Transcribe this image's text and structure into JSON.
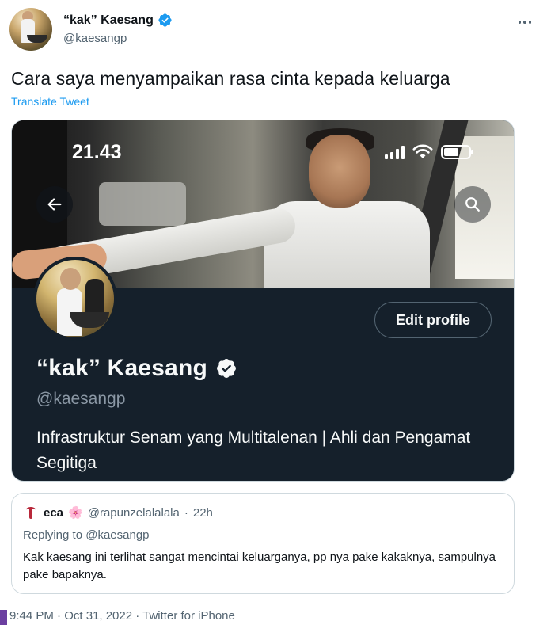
{
  "tweet": {
    "author_name": "“kak” Kaesang",
    "author_handle": "@kaesangp",
    "text": "Cara saya menyampaikan rasa cinta kepada keluarga",
    "translate_label": "Translate Tweet",
    "meta": "9:44 PM · Oct 31, 2022 · Twitter for iPhone"
  },
  "media": {
    "status_time": "21.43",
    "edit_profile_label": "Edit profile",
    "profile_name": "“kak” Kaesang",
    "profile_handle": "@kaesangp",
    "profile_bio": "Infrastruktur Senam yang Multitalenan | Ahli dan Pengamat Segitiga"
  },
  "quoted": {
    "name": "eca",
    "emoji": "🌸",
    "handle": "@rapunzelalalala",
    "separator": "·",
    "time": "22h",
    "reply_prefix": "Replying to",
    "reply_handle": "@kaesangp",
    "text": "Kak kaesang ini terlihat sangat mencintai keluarganya, pp nya pake kakaknya, sampulnya pake bapaknya."
  },
  "colors": {
    "accent": "#1d9bf0",
    "profile_bg": "#15202b",
    "muted": "#536471"
  },
  "icons": [
    "verified-icon",
    "more-icon",
    "back-arrow-icon",
    "search-icon",
    "signal-icon",
    "wifi-icon",
    "battery-icon"
  ]
}
